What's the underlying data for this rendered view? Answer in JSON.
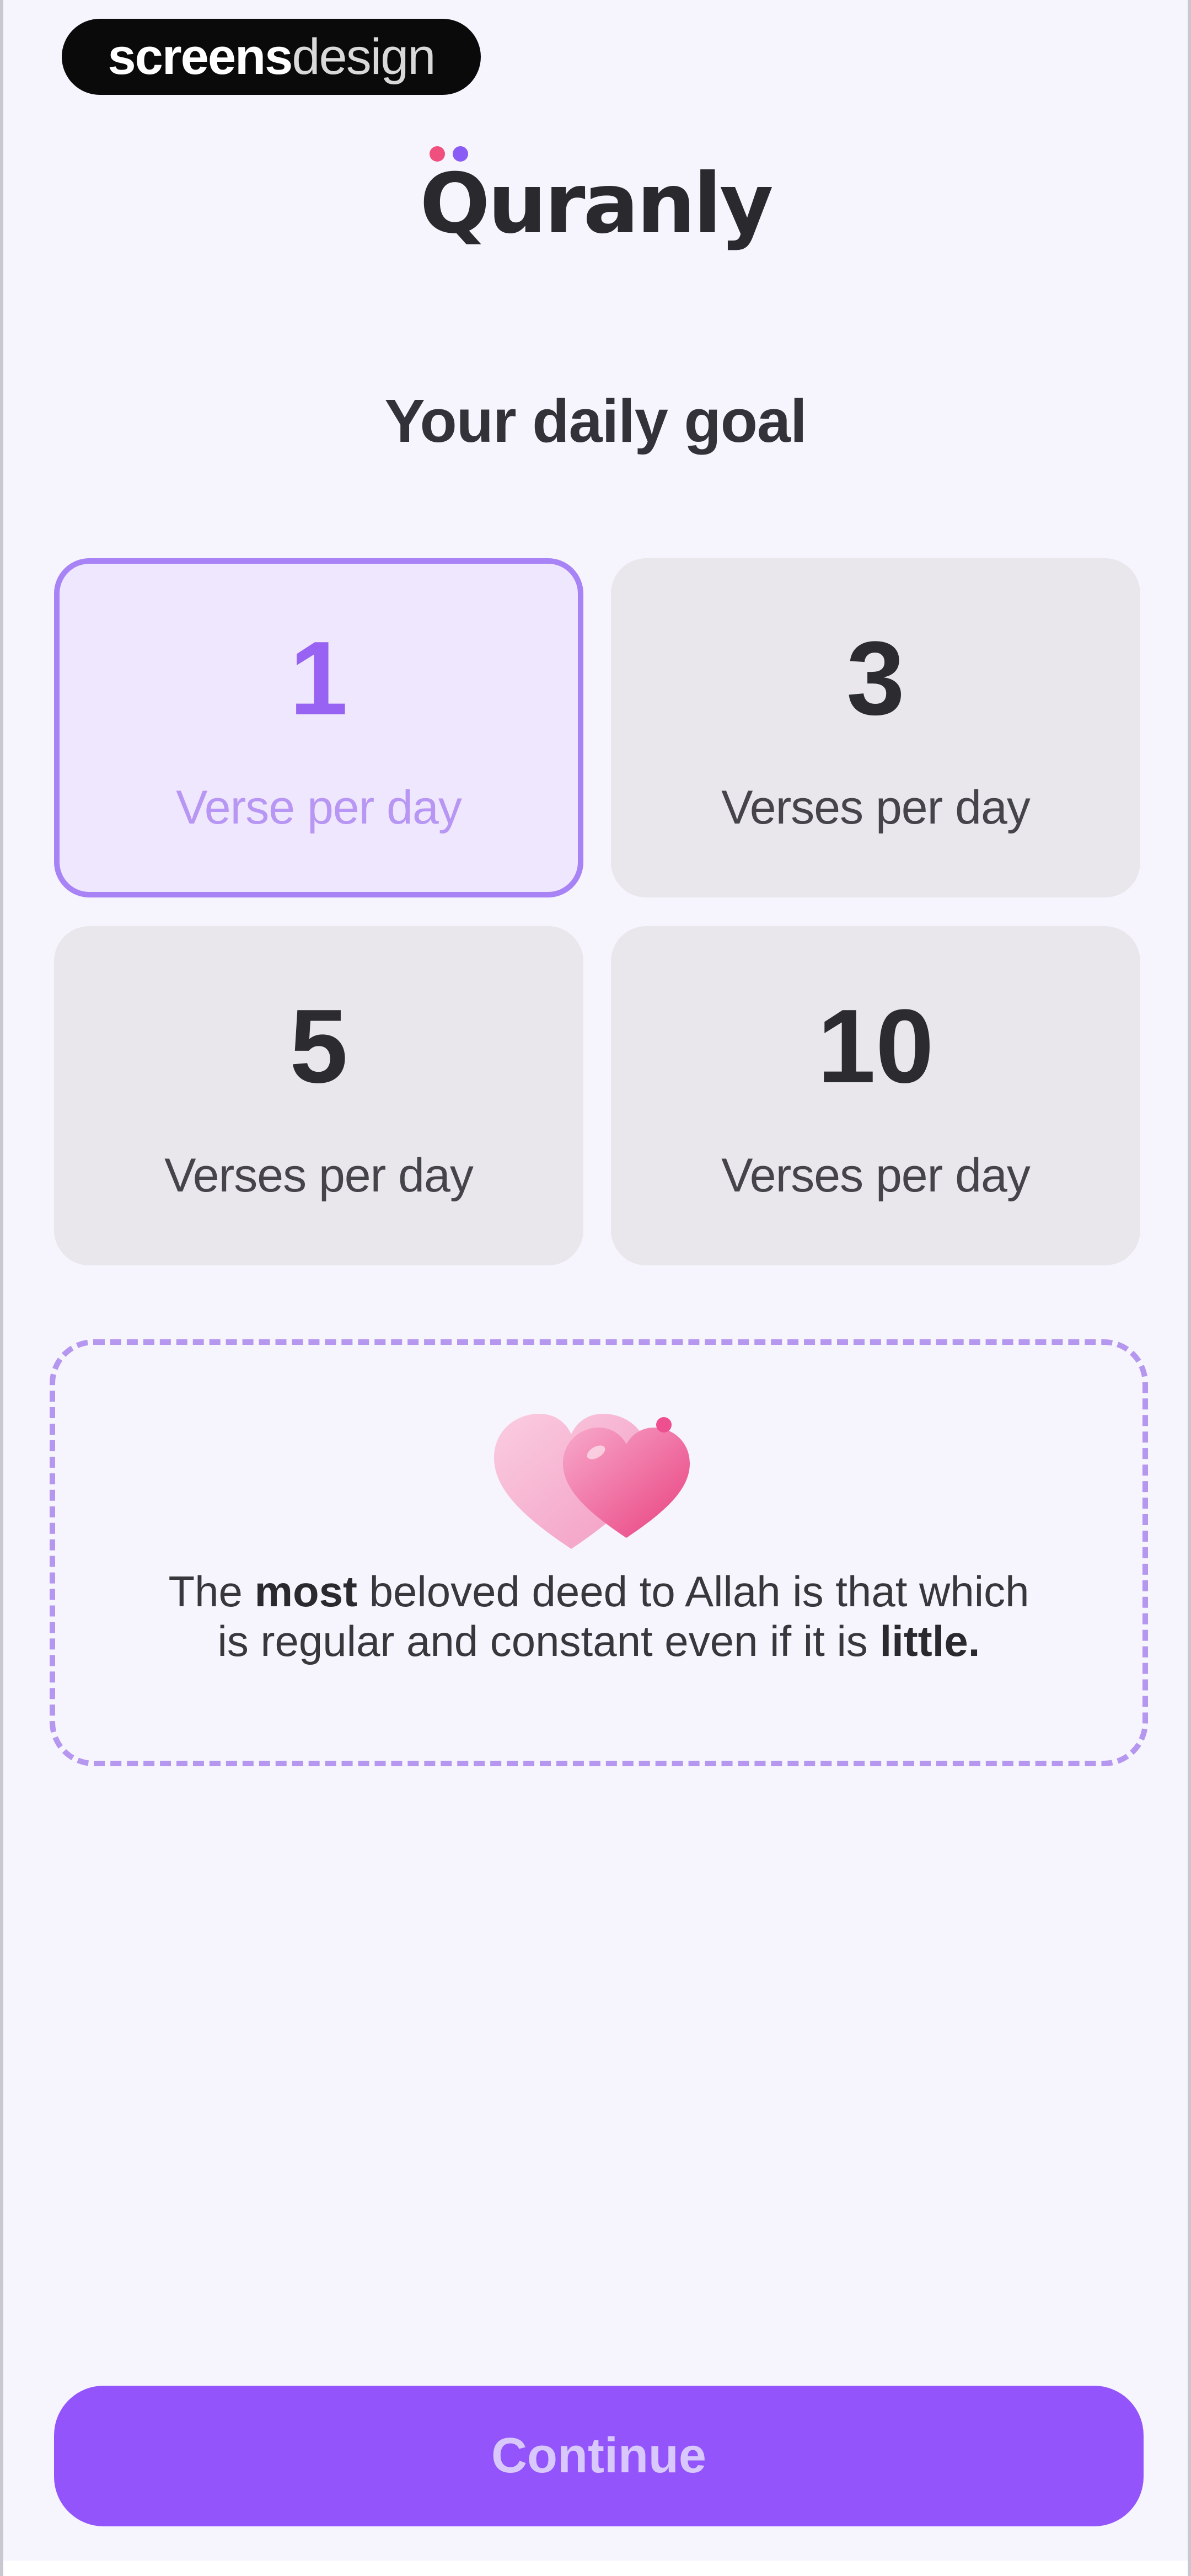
{
  "watermark": {
    "part1": "screens",
    "part2": "design"
  },
  "logo": {
    "text": "Quranly",
    "dot_colors": [
      "#f0507d",
      "#8a5cf5"
    ]
  },
  "title": "Your daily goal",
  "goals": [
    {
      "number": "1",
      "unit": "Verse per day",
      "selected": true
    },
    {
      "number": "3",
      "unit": "Verses per day",
      "selected": false
    },
    {
      "number": "5",
      "unit": "Verses per day",
      "selected": false
    },
    {
      "number": "10",
      "unit": "Verses per day",
      "selected": false
    }
  ],
  "quote": {
    "icon": "hearts-icon",
    "part1": "The ",
    "bold1": "most",
    "part2": " beloved deed to Allah is that which is regular and constant even if it is ",
    "bold2": "little."
  },
  "continue_label": "Continue",
  "colors": {
    "accent": "#9355fb",
    "selected_border": "#a783f5",
    "selected_bg": "#efe7fd",
    "card_bg": "#e9e7ec",
    "background": "#f6f4fd",
    "heart_pink": "#ee4f8f"
  }
}
